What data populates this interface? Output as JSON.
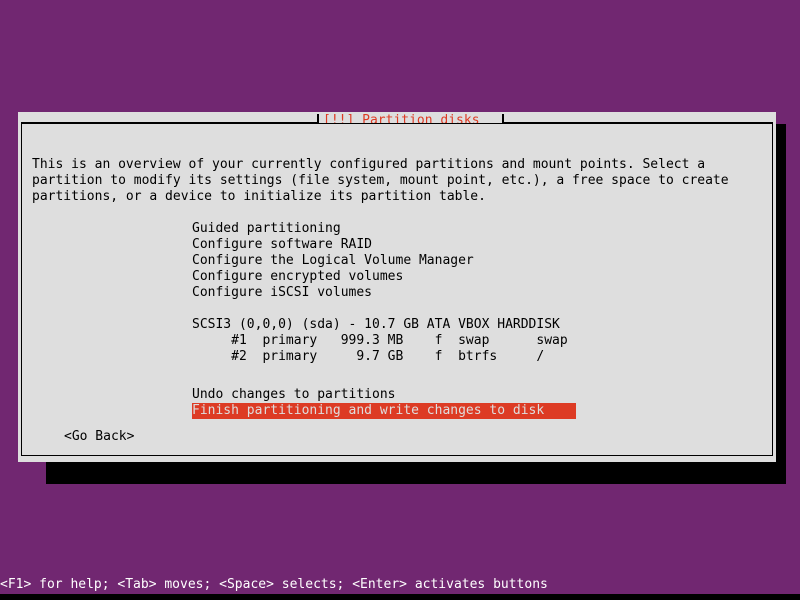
{
  "colors": {
    "desktop_background": "#712771",
    "dialog_background": "#dedede",
    "dialog_border": "#000000",
    "title_accent": "#dd3b24",
    "selection_background": "#dd3b24",
    "selection_foreground": "#dedede",
    "status_bar_background": "#712771",
    "status_bar_foreground": "#ffffff",
    "shadow": "#000000"
  },
  "dialog": {
    "title": "[!!] Partition disks",
    "description": "This is an overview of your currently configured partitions and mount points. Select a\npartition to modify its settings (file system, mount point, etc.), a free space to create\npartitions, or a device to initialize its partition table.",
    "menu_items": "Guided partitioning\nConfigure software RAID\nConfigure the Logical Volume Manager\nConfigure encrypted volumes\nConfigure iSCSI volumes",
    "menu_item_list": [
      "Guided partitioning",
      "Configure software RAID",
      "Configure the Logical Volume Manager",
      "Configure encrypted volumes",
      "Configure iSCSI volumes"
    ],
    "device_block": "SCSI3 (0,0,0) (sda) - 10.7 GB ATA VBOX HARDDISK\n     #1  primary   999.3 MB    f  swap      swap\n     #2  primary     9.7 GB    f  btrfs     /",
    "device": {
      "label": "SCSI3 (0,0,0) (sda) - 10.7 GB ATA VBOX HARDDISK",
      "bus": "SCSI3",
      "address": "(0,0,0)",
      "node": "(sda)",
      "size": "10.7 GB",
      "model": "ATA VBOX HARDDISK",
      "partitions": [
        {
          "number": "#1",
          "type": "primary",
          "size": "999.3 MB",
          "flag": "f",
          "filesystem": "swap",
          "mount_point": "swap"
        },
        {
          "number": "#2",
          "type": "primary",
          "size": "9.7 GB",
          "flag": "f",
          "filesystem": "btrfs",
          "mount_point": "/"
        }
      ]
    },
    "actions": {
      "undo": "Undo changes to partitions",
      "finish": "Finish partitioning and write changes to disk",
      "selected": "Finish partitioning and write changes to disk"
    },
    "go_back_button": "<Go Back>"
  },
  "status_bar": {
    "hint": "<F1> for help; <Tab> moves; <Space> selects; <Enter> activates buttons"
  }
}
